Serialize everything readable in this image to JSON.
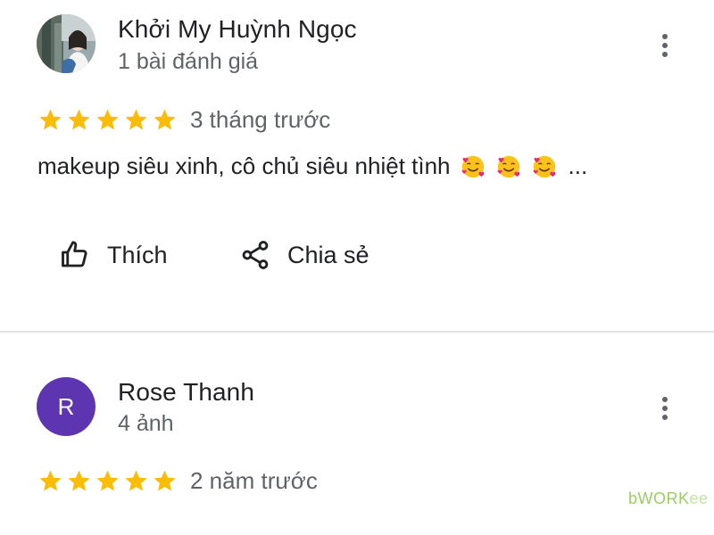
{
  "colors": {
    "star": "#fbbc04",
    "secondary_text": "#5f6368",
    "primary_text": "#202124",
    "avatar_purple": "#5e35b1",
    "divider": "#e3e3e3",
    "watermark": "#9ccc65"
  },
  "reviews": [
    {
      "author": {
        "name": "Khởi My Huỳnh Ngọc",
        "meta": "1 bài đánh giá",
        "avatar": "photo-avatar"
      },
      "rating": 5,
      "time_ago": "3 tháng trước",
      "text": "makeup siêu xinh, cô chủ siêu nhiệt tình",
      "emojis": [
        "smiling-face-with-hearts-emoji",
        "smiling-face-with-hearts-emoji",
        "smiling-face-with-hearts-emoji"
      ],
      "ellipsis": "...",
      "actions": {
        "like_label": "Thích",
        "share_label": "Chia sẻ"
      },
      "more_icon": "more-vert-icon"
    },
    {
      "author": {
        "name": "Rose Thanh",
        "meta": "4 ảnh",
        "avatar_initial": "R"
      },
      "rating": 5,
      "time_ago": "2 năm trước",
      "more_icon": "more-vert-icon"
    }
  ],
  "watermark": {
    "part1": "b",
    "part2": "WORK",
    "part3": "ee"
  }
}
